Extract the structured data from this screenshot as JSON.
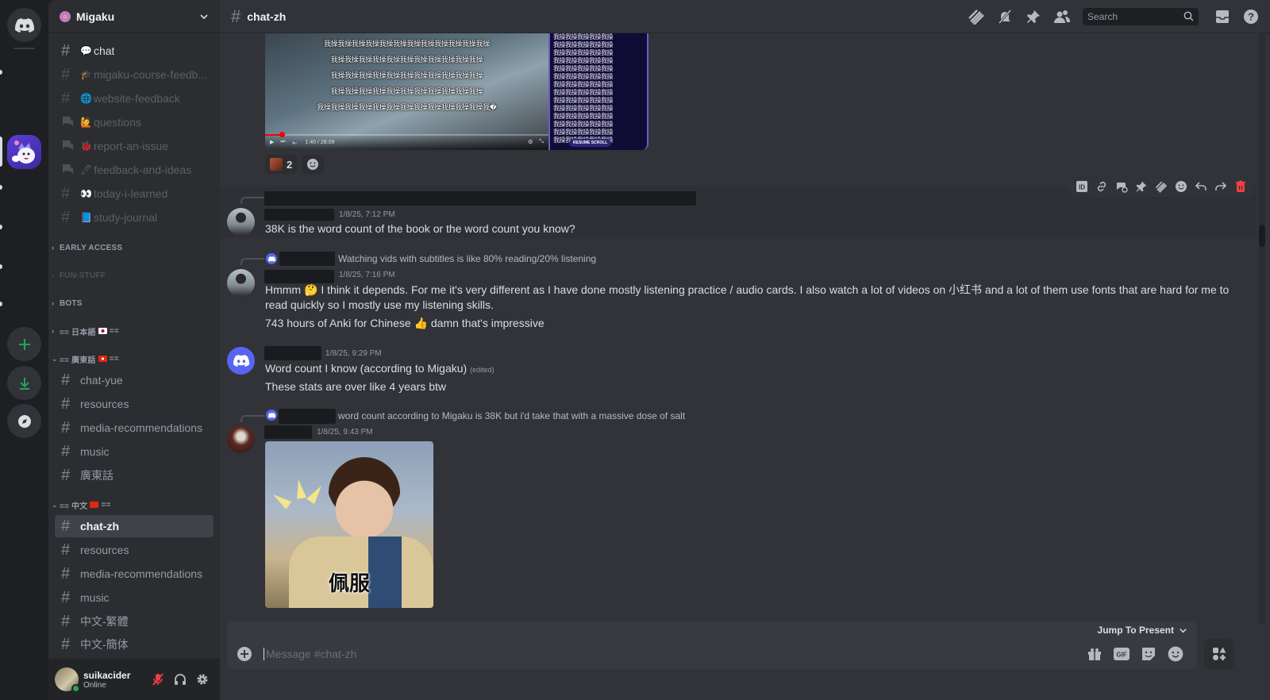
{
  "server": {
    "name": "Migaku",
    "channels_top": [
      {
        "emoji": "💬",
        "label": "chat",
        "type": "text",
        "state": "bright"
      },
      {
        "emoji": "🎓",
        "label": "migaku-course-feedb...",
        "type": "text",
        "state": "muted"
      },
      {
        "emoji": "🌐",
        "label": "website-feedback",
        "type": "text",
        "state": "muted"
      },
      {
        "emoji": "🙋",
        "label": "questions",
        "type": "forum",
        "state": "muted"
      },
      {
        "emoji": "🐞",
        "label": "report-an-issue",
        "type": "forum",
        "state": "muted"
      },
      {
        "emoji": "🖊",
        "label": "feedback-and-ideas",
        "type": "forum",
        "state": "muted"
      },
      {
        "emoji": "👀",
        "label": "today-i-learned",
        "type": "text",
        "state": "muted"
      },
      {
        "emoji": "📘",
        "label": "study-journal",
        "type": "text",
        "state": "muted"
      }
    ],
    "categories": [
      {
        "label": "EARLY ACCESS",
        "collapsed": true
      },
      {
        "label": "FUN-STUFF",
        "collapsed": true
      },
      {
        "label": "BOTS",
        "collapsed": true
      },
      {
        "label": "== 日本語",
        "suffix": "==",
        "collapsed": true
      },
      {
        "label": "== 廣東話",
        "suffix": "==",
        "collapsed": false
      },
      {
        "label": "== 中文",
        "suffix": "==",
        "collapsed": false
      }
    ],
    "cantonese_channels": [
      "chat-yue",
      "resources",
      "media-recommendations",
      "music",
      "廣東話"
    ],
    "chinese_channels": [
      "chat-zh",
      "resources",
      "media-recommendations",
      "music",
      "中文-繁體",
      "中文-簡体"
    ]
  },
  "user": {
    "name": "suikacider",
    "status": "Online"
  },
  "channel": {
    "name": "chat-zh",
    "search_placeholder": "Search",
    "composer_placeholder": "Message #chat-zh",
    "jump_label": "Jump To Present"
  },
  "video": {
    "subtitle_lines": [
      "我操我操我操我操我操我操我操我操我操我操我操我操",
      "我操我操我操我操我操我操我操我操我操我操我操",
      "我操我操我操我操我操我操我操我操我操我操我操",
      "我操我操我操我操我操我操我操我操我操我操我操",
      "我操我操我操我操我操我操我操我操我操我操我操我操我�"
    ],
    "time": "1:40 / 28:09",
    "progress_fraction": 0.06,
    "chat_line": "我操我操我操我操我操",
    "resume_label": "RESUME SCROLL"
  },
  "reactions": [
    {
      "count": "2"
    }
  ],
  "messages": [
    {
      "timestamp": "1/8/25, 7:12 PM",
      "lines": [
        "38K is the word count of the book or the word count you know?"
      ]
    },
    {
      "reply_text": "Watching vids with subtitles is like 80% reading/20% listening",
      "timestamp": "1/8/25, 7:16 PM",
      "line1_a": "Hmmm",
      "line1_emoji": "🤔",
      "line1_b": "I think it depends. For me it's very different as I have done mostly listening practice / audio cards. I also watch a lot of videos on 小红书 and a lot of them use fonts that are hard for me to",
      "line2": "read quickly so I mostly use my listening skills.",
      "line3_a": "743 hours of Anki for Chinese",
      "line3_emoji": "👍",
      "line3_b": "damn that's impressive"
    },
    {
      "timestamp": "1/8/25, 9:29 PM",
      "line1": "Word count I know (according to Migaku)",
      "edited": "(edited)",
      "line2": "These stats are over like 4 years btw"
    },
    {
      "reply_text": "word count according to Migaku is 38K but i'd take that with a massive dose of salt",
      "timestamp": "1/8/25, 9:43 PM",
      "sticker_caption": "佩服"
    }
  ]
}
